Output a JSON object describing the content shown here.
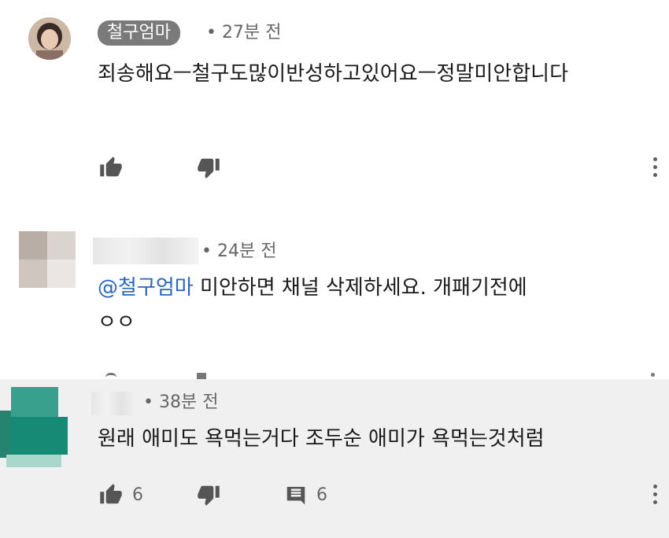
{
  "comments": [
    {
      "author": "철구엄마",
      "time": "• 27분 전",
      "text": "죄송해요ㅡ철구도많이반성하고있어요ㅡ정말미안합니다",
      "likes": "",
      "reply_count": ""
    },
    {
      "author": "",
      "time": "• 24분 전",
      "mention": "@철구엄마",
      "text_line1": " 미안하면 채널 삭제하세요. 개패기전에",
      "text_line2": "ㅇㅇ"
    },
    {
      "author": "",
      "time": "• 38분 전",
      "text": "원래 애미도 욕먹는거다 조두순 애미가 욕먹는것처럼",
      "likes": "6",
      "reply_count": "6"
    }
  ],
  "icons": {
    "like": "thumb-up-icon",
    "dislike": "thumb-down-icon",
    "reply": "comment-icon",
    "menu": "more-vert-icon"
  },
  "colors": {
    "mention": "#2a67b8",
    "name_pill": "#7a7a7a",
    "highlight_bg": "#f0f0f0",
    "avatar_teal": "#1f8f7e"
  }
}
